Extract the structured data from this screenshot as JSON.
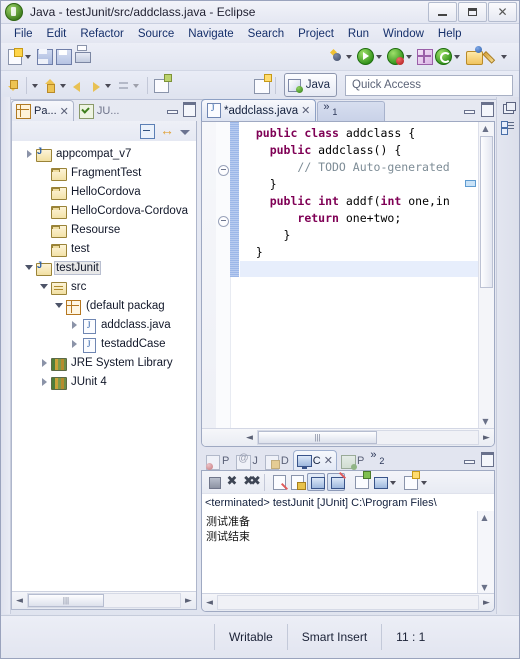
{
  "window": {
    "title": "Java - testJunit/src/addclass.java - Eclipse",
    "app_icon": "eclipse-icon",
    "controls": {
      "minimize": "minimize",
      "restore": "restore",
      "close": "close"
    }
  },
  "menubar": {
    "items": [
      "File",
      "Edit",
      "Refactor",
      "Source",
      "Navigate",
      "Search",
      "Project",
      "Run",
      "Window",
      "Help"
    ]
  },
  "toolbar": {
    "row1": [
      {
        "name": "new-wizard-icon",
        "label": "New"
      },
      {
        "name": "save-icon",
        "label": "Save"
      },
      {
        "name": "save-all-icon",
        "label": "Save All"
      },
      {
        "name": "print-icon",
        "label": "Print"
      },
      {
        "name": "debug-icon",
        "label": "Debug"
      },
      {
        "name": "run-icon",
        "label": "Run"
      },
      {
        "name": "run-coverage-icon",
        "label": "Coverage"
      },
      {
        "name": "new-java-package-icon",
        "label": "New Java Package"
      },
      {
        "name": "external-tools-icon",
        "label": "External Tools"
      },
      {
        "name": "open-type-icon",
        "label": "Open Type"
      },
      {
        "name": "annotation-icon",
        "label": "Annotation"
      }
    ],
    "row2": [
      {
        "name": "next-annotation-icon",
        "label": "Next Annotation"
      },
      {
        "name": "previous-annotation-icon",
        "label": "Previous Annotation"
      },
      {
        "name": "back-icon",
        "label": "Back"
      },
      {
        "name": "forward-icon",
        "label": "Forward"
      },
      {
        "name": "last-edit-icon",
        "label": "Last Edit Location"
      },
      {
        "name": "new-window-icon",
        "label": "New Window"
      }
    ],
    "open_perspective_icon": "open-perspective-icon",
    "perspective_button": "Java",
    "quick_access_placeholder": "Quick Access"
  },
  "package_explorer": {
    "tabs": [
      {
        "label": "Pa...",
        "icon": "package-explorer-icon",
        "active": true,
        "closeable": true
      },
      {
        "label": "JU...",
        "icon": "junit-icon",
        "active": false,
        "closeable": false
      }
    ],
    "view_actions": [
      {
        "name": "collapse-all-icon",
        "label": "Collapse All"
      },
      {
        "name": "link-with-editor-icon",
        "label": "Link with Editor"
      },
      {
        "name": "view-menu-icon",
        "label": "View Menu"
      }
    ],
    "minimize_label": "Minimize",
    "maximize_label": "Maximize",
    "tree": [
      {
        "label": "appcompat_v7",
        "icon": "java-project-icon",
        "indent": 0,
        "twisty": "closed",
        "selected": false
      },
      {
        "label": "FragmentTest",
        "icon": "folder-icon",
        "indent": 1,
        "twisty": "none",
        "selected": false
      },
      {
        "label": "HelloCordova",
        "icon": "folder-icon",
        "indent": 1,
        "twisty": "none",
        "selected": false
      },
      {
        "label": "HelloCordova-Cordova",
        "icon": "folder-icon",
        "indent": 1,
        "twisty": "none",
        "selected": false
      },
      {
        "label": "Resourse",
        "icon": "folder-icon",
        "indent": 1,
        "twisty": "none",
        "selected": false
      },
      {
        "label": "test",
        "icon": "folder-icon",
        "indent": 1,
        "twisty": "none",
        "selected": false
      },
      {
        "label": "testJunit",
        "icon": "java-project-icon",
        "indent": 0,
        "twisty": "open",
        "selected": true
      },
      {
        "label": "src",
        "icon": "source-folder-icon",
        "indent": 1,
        "twisty": "open",
        "selected": false
      },
      {
        "label": "(default packag",
        "icon": "package-icon",
        "indent": 2,
        "twisty": "open",
        "selected": false
      },
      {
        "label": "addclass.java",
        "icon": "java-file-icon",
        "indent": 3,
        "twisty": "closed",
        "selected": false
      },
      {
        "label": "testaddCase",
        "icon": "java-file-icon",
        "indent": 3,
        "twisty": "closed",
        "selected": false
      },
      {
        "label": "JRE System Library",
        "icon": "library-icon",
        "indent": 1,
        "twisty": "closed",
        "selected": false
      },
      {
        "label": "JUnit 4",
        "icon": "library-icon",
        "indent": 1,
        "twisty": "closed",
        "selected": false
      }
    ],
    "scroll_left_arrow": "◄",
    "scroll_right_arrow": "►"
  },
  "editor": {
    "tab": {
      "label": "*addclass.java",
      "icon": "java-file-icon",
      "dirty": true
    },
    "overflow": {
      "chevron": "»",
      "count": "1"
    },
    "minimize_label": "Minimize",
    "maximize_label": "Maximize",
    "code_lines": [
      {
        "indent": 1,
        "parts": [
          {
            "t": "public",
            "c": "kw"
          },
          {
            "t": " "
          },
          {
            "t": "class",
            "c": "kw"
          },
          {
            "t": " addclass {"
          }
        ]
      },
      {
        "indent": 0,
        "parts": [
          {
            "t": ""
          }
        ]
      },
      {
        "indent": 2,
        "parts": [
          {
            "t": "public",
            "c": "kw"
          },
          {
            "t": " addclass() {"
          }
        ]
      },
      {
        "indent": 4,
        "parts": [
          {
            "t": "// TODO Auto-generated",
            "c": "cmt"
          }
        ]
      },
      {
        "indent": 2,
        "parts": [
          {
            "t": "}"
          }
        ]
      },
      {
        "indent": 2,
        "parts": [
          {
            "t": "public",
            "c": "kw"
          },
          {
            "t": " "
          },
          {
            "t": "int",
            "c": "kw"
          },
          {
            "t": " addf("
          },
          {
            "t": "int",
            "c": "kw"
          },
          {
            "t": " one,in"
          }
        ]
      },
      {
        "indent": 4,
        "parts": [
          {
            "t": "return",
            "c": "kw"
          },
          {
            "t": " one+two;"
          }
        ]
      },
      {
        "indent": 3,
        "parts": [
          {
            "t": "}"
          }
        ]
      },
      {
        "indent": 1,
        "parts": [
          {
            "t": "}"
          }
        ]
      }
    ],
    "scroll_left_arrow": "◄",
    "scroll_right_arrow": "►",
    "scroll_up_arrow": "▲",
    "scroll_down_arrow": "▼"
  },
  "console": {
    "tabs": [
      {
        "label": "P",
        "icon": "problems-icon",
        "active": false,
        "closeable": false
      },
      {
        "label": "J",
        "icon": "javadoc-icon",
        "active": false,
        "closeable": false
      },
      {
        "label": "D",
        "icon": "declaration-icon",
        "active": false,
        "closeable": false
      },
      {
        "label": "C",
        "icon": "console-icon",
        "active": true,
        "closeable": true
      },
      {
        "label": "P",
        "icon": "progress-icon",
        "active": false,
        "closeable": false
      }
    ],
    "overflow": {
      "chevron": "»",
      "count": "2"
    },
    "minimize_label": "Minimize",
    "maximize_label": "Maximize",
    "toolbar": [
      {
        "name": "terminate-icon",
        "label": "Terminate"
      },
      {
        "name": "remove-launch-icon",
        "label": "Remove Launch"
      },
      {
        "name": "remove-all-terminated-icon",
        "label": "Remove All Terminated Launches"
      },
      {
        "name": "clear-console-icon",
        "label": "Clear Console"
      },
      {
        "name": "scroll-lock-icon",
        "label": "Scroll Lock"
      },
      {
        "name": "pin-console-icon",
        "label": "Pin Console",
        "pressed": true
      },
      {
        "name": "show-console-on-output-icon",
        "label": "Show Console When Output Changes",
        "pressed": true
      },
      {
        "name": "open-console-icon",
        "label": "Open Console"
      },
      {
        "name": "display-selected-console-icon",
        "label": "Display Selected Console"
      },
      {
        "name": "new-console-view-icon",
        "label": "New Console View"
      }
    ],
    "launch_label": "<terminated> testJunit [JUnit] C:\\Program Files\\",
    "output_lines": [
      "测试准备",
      "测试结束"
    ],
    "scroll_up_arrow": "▲",
    "scroll_down_arrow": "▼",
    "scroll_left_arrow": "◄",
    "scroll_right_arrow": "►"
  },
  "statusbar": {
    "writable": "Writable",
    "insert_mode": "Smart Insert",
    "position": "11 : 1"
  },
  "right_strip": {
    "restore_label": "Restore",
    "outline_label": "Outline"
  }
}
